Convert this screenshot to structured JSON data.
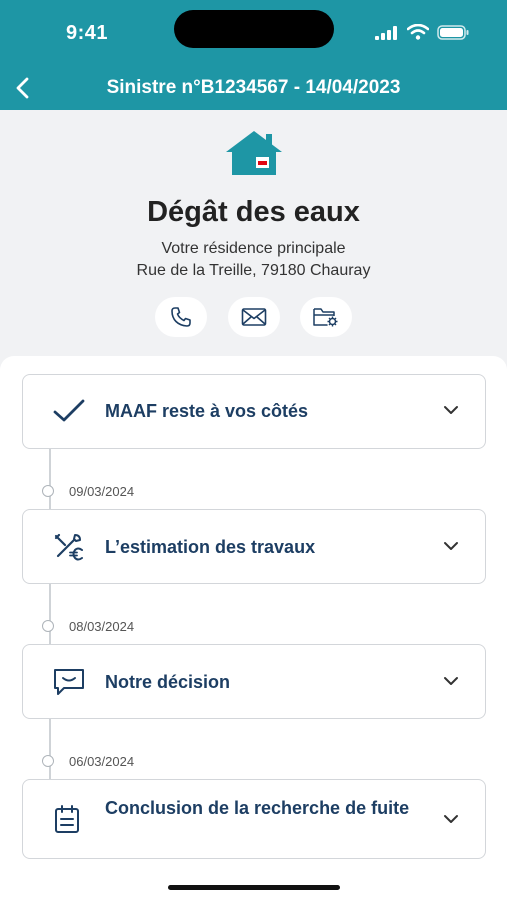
{
  "status": {
    "time": "9:41"
  },
  "header": {
    "title": "Sinistre n°B1234567 - 14/04/2023"
  },
  "claim": {
    "title": "Dégât des eaux",
    "residence": "Votre résidence principale",
    "address": "Rue de la Treille, 79180 Chauray"
  },
  "colors": {
    "brand": "#1e96a5",
    "navy": "#1d3e63",
    "accent_red": "#e30613"
  },
  "timeline": [
    {
      "label": "MAAF reste à vos côtés",
      "icon": "checkmark-icon"
    },
    {
      "date": "09/03/2024",
      "label": "L’estimation des travaux",
      "icon": "tools-euro-icon"
    },
    {
      "date": "08/03/2024",
      "label": "Notre décision",
      "icon": "message-icon"
    },
    {
      "date": "06/03/2024",
      "label": "Conclusion de la recherche de fuite",
      "icon": "clipboard-icon"
    }
  ]
}
